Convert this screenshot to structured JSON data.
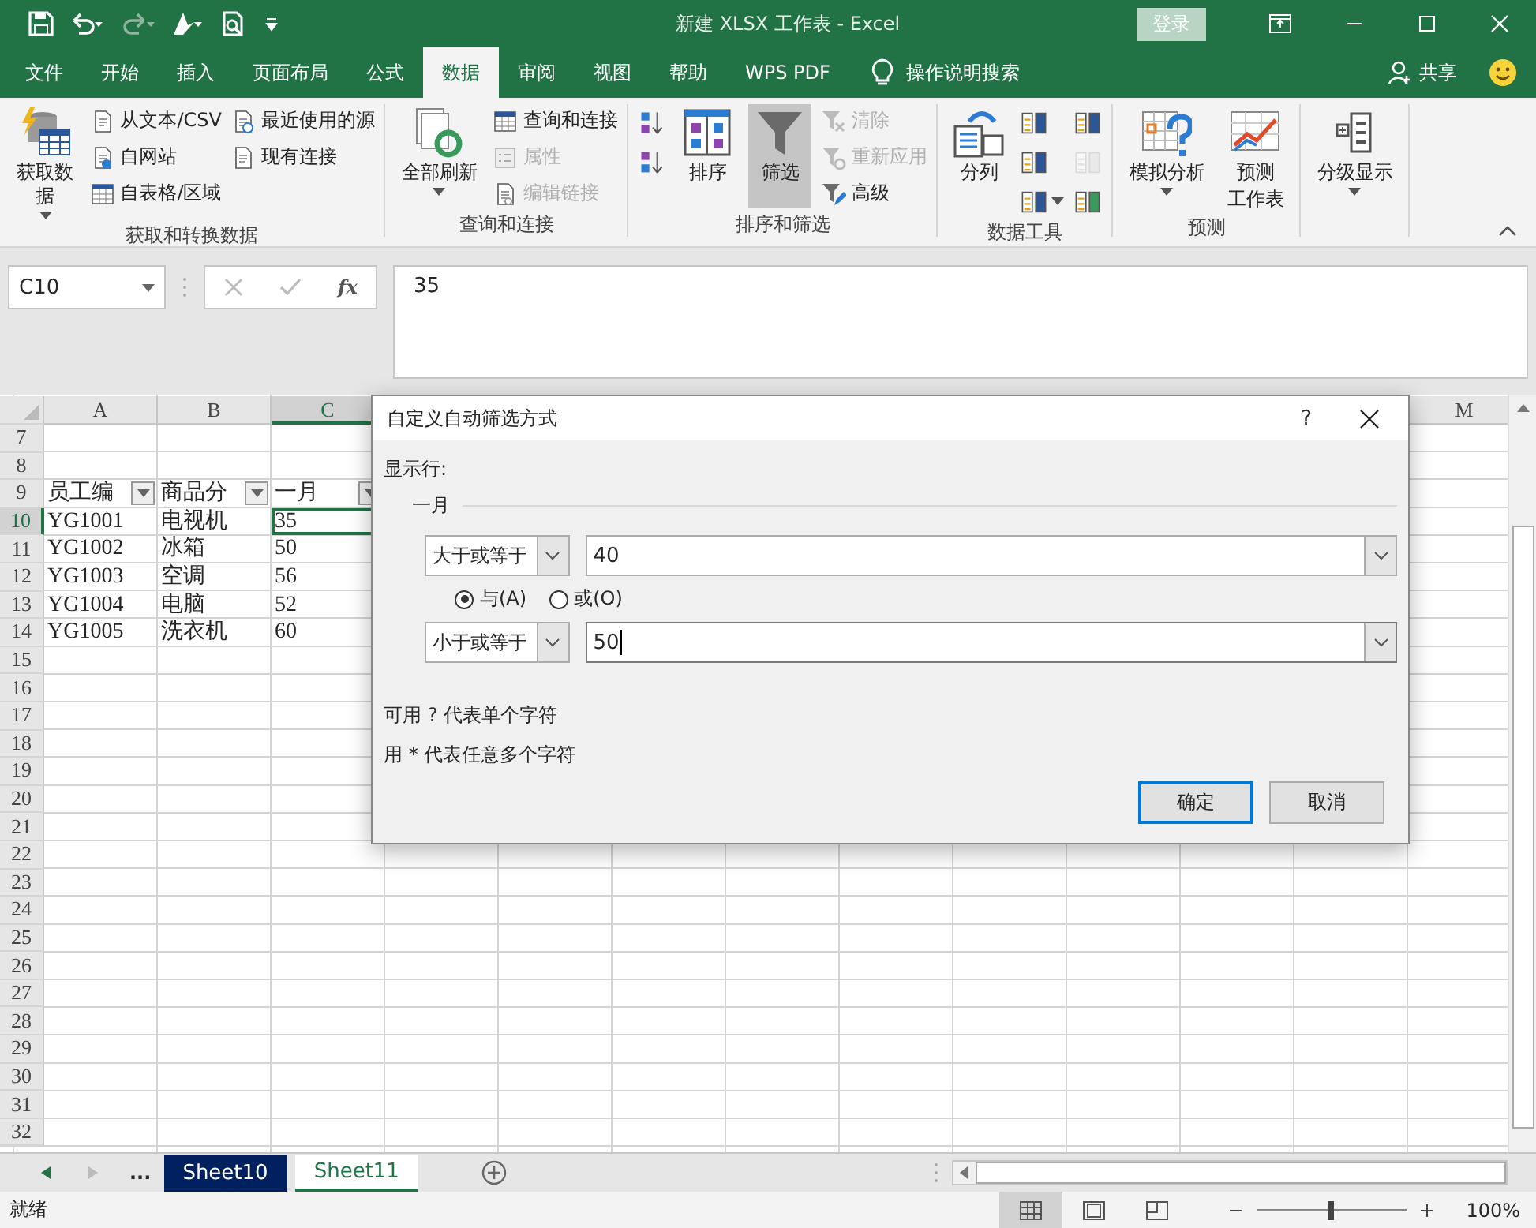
{
  "window": {
    "title": "新建 XLSX 工作表  -  Excel",
    "sign_in": "登录"
  },
  "tabs": [
    {
      "label": "文件",
      "selected": false
    },
    {
      "label": "开始",
      "selected": false
    },
    {
      "label": "插入",
      "selected": false
    },
    {
      "label": "页面布局",
      "selected": false
    },
    {
      "label": "公式",
      "selected": false
    },
    {
      "label": "数据",
      "selected": true
    },
    {
      "label": "审阅",
      "selected": false
    },
    {
      "label": "视图",
      "selected": false
    },
    {
      "label": "帮助",
      "selected": false
    },
    {
      "label": "WPS PDF",
      "selected": false
    }
  ],
  "tell_me": "操作说明搜索",
  "share": "共享",
  "ribbon": [
    {
      "label": "获取和转换数据",
      "columns": [
        {
          "kind": "large",
          "lines": [
            "获取数据"
          ],
          "dropdown": true,
          "pressed": false
        },
        {
          "kind": "stack",
          "items": [
            {
              "label": "从文本/CSV",
              "disabled": false
            },
            {
              "label": "自网站",
              "disabled": false
            },
            {
              "label": "自表格/区域",
              "disabled": false
            }
          ]
        },
        {
          "kind": "stack",
          "items": [
            {
              "label": "最近使用的源",
              "disabled": false
            },
            {
              "label": "现有连接",
              "disabled": false
            }
          ]
        }
      ]
    },
    {
      "label": "查询和连接",
      "columns": [
        {
          "kind": "large",
          "lines": [
            "全部刷新"
          ],
          "dropdown": true,
          "pressed": false
        },
        {
          "kind": "stack",
          "items": [
            {
              "label": "查询和连接",
              "disabled": false
            },
            {
              "label": "属性",
              "disabled": true
            },
            {
              "label": "编辑链接",
              "disabled": true
            }
          ]
        }
      ]
    },
    {
      "label": "排序和筛选",
      "columns": [
        {
          "kind": "icons",
          "items": [
            {
              "disabled": false,
              "dropdown": false
            },
            {
              "disabled": false,
              "dropdown": false
            }
          ]
        },
        {
          "kind": "large",
          "lines": [
            "排序"
          ],
          "dropdown": false,
          "pressed": false
        },
        {
          "kind": "large",
          "lines": [
            "筛选"
          ],
          "dropdown": false,
          "pressed": true
        },
        {
          "kind": "stack",
          "items": [
            {
              "label": "清除",
              "disabled": true
            },
            {
              "label": "重新应用",
              "disabled": true
            },
            {
              "label": "高级",
              "disabled": false
            }
          ]
        }
      ]
    },
    {
      "label": "数据工具",
      "columns": [
        {
          "kind": "large",
          "lines": [
            "分列"
          ],
          "dropdown": false,
          "pressed": false
        },
        {
          "kind": "icons",
          "items": [
            {
              "disabled": false,
              "dropdown": false
            },
            {
              "disabled": false,
              "dropdown": false
            },
            {
              "disabled": false,
              "dropdown": true
            }
          ]
        },
        {
          "kind": "icons",
          "items": [
            {
              "disabled": false,
              "dropdown": false
            },
            {
              "disabled": true,
              "dropdown": false
            },
            {
              "disabled": false,
              "dropdown": false
            }
          ]
        }
      ]
    },
    {
      "label": "预测",
      "columns": [
        {
          "kind": "large",
          "lines": [
            "模拟分析"
          ],
          "dropdown": true,
          "pressed": false
        },
        {
          "kind": "large",
          "lines": [
            "预测",
            "工作表"
          ],
          "dropdown": false,
          "pressed": false
        }
      ]
    },
    {
      "columns": [
        {
          "kind": "large",
          "lines": [
            "分级显示"
          ],
          "dropdown": true,
          "pressed": false
        }
      ]
    }
  ],
  "formula_bar": {
    "name_box": "C10",
    "fx": "fx",
    "formula": "35"
  },
  "grid": {
    "columns": [
      {
        "label": "A",
        "selected": false
      },
      {
        "label": "B",
        "selected": false
      },
      {
        "label": "C",
        "selected": true
      },
      {
        "label": "M",
        "selected": false
      }
    ],
    "rows": [
      {
        "number": "7",
        "selected": false
      },
      {
        "number": "8",
        "selected": false
      },
      {
        "number": "9",
        "selected": false,
        "cells": [
          {
            "text": "员工编",
            "filter": true,
            "selected": false
          },
          {
            "text": "商品分",
            "filter": true,
            "selected": false
          },
          {
            "text": "一月",
            "filter": true,
            "selected": false
          }
        ]
      },
      {
        "number": "10",
        "selected": true,
        "cells": [
          {
            "text": "YG1001",
            "filter": false,
            "selected": false
          },
          {
            "text": "电视机",
            "filter": false,
            "selected": false
          },
          {
            "text": "35",
            "filter": false,
            "selected": true
          }
        ]
      },
      {
        "number": "11",
        "selected": false,
        "cells": [
          {
            "text": "YG1002",
            "filter": false,
            "selected": false
          },
          {
            "text": "冰箱",
            "filter": false,
            "selected": false
          },
          {
            "text": "50",
            "filter": false,
            "selected": false
          }
        ]
      },
      {
        "number": "12",
        "selected": false,
        "cells": [
          {
            "text": "YG1003",
            "filter": false,
            "selected": false
          },
          {
            "text": "空调",
            "filter": false,
            "selected": false
          },
          {
            "text": "56",
            "filter": false,
            "selected": false
          }
        ]
      },
      {
        "number": "13",
        "selected": false,
        "cells": [
          {
            "text": "YG1004",
            "filter": false,
            "selected": false
          },
          {
            "text": "电脑",
            "filter": false,
            "selected": false
          },
          {
            "text": "52",
            "filter": false,
            "selected": false
          }
        ]
      },
      {
        "number": "14",
        "selected": false,
        "cells": [
          {
            "text": "YG1005",
            "filter": false,
            "selected": false
          },
          {
            "text": "洗衣机",
            "filter": false,
            "selected": false
          },
          {
            "text": "60",
            "filter": false,
            "selected": false
          }
        ]
      },
      {
        "number": "15",
        "selected": false
      },
      {
        "number": "16",
        "selected": false
      },
      {
        "number": "17",
        "selected": false
      },
      {
        "number": "18",
        "selected": false
      },
      {
        "number": "19",
        "selected": false
      },
      {
        "number": "20",
        "selected": false
      },
      {
        "number": "21",
        "selected": false
      },
      {
        "number": "22",
        "selected": false
      },
      {
        "number": "23",
        "selected": false
      },
      {
        "number": "24",
        "selected": false
      },
      {
        "number": "25",
        "selected": false
      },
      {
        "number": "26",
        "selected": false
      },
      {
        "number": "27",
        "selected": false
      },
      {
        "number": "28",
        "selected": false
      },
      {
        "number": "29",
        "selected": false
      },
      {
        "number": "30",
        "selected": false
      },
      {
        "number": "31",
        "selected": false
      },
      {
        "number": "32",
        "selected": false
      }
    ]
  },
  "dialog": {
    "title": "自定义自动筛选方式",
    "help": "?",
    "show_rows": "显示行:",
    "field": "一月",
    "conditions": [
      {
        "operator": "大于或等于",
        "value": "40",
        "focused": false
      },
      {
        "operator": "小于或等于",
        "value": "50",
        "focused": true
      }
    ],
    "logic": [
      {
        "label": "与(A)",
        "selected": true
      },
      {
        "label": "或(O)",
        "selected": false
      }
    ],
    "hints": [
      "可用 ? 代表单个字符",
      "用 * 代表任意多个字符"
    ],
    "buttons": [
      {
        "label": "确定",
        "default": true
      },
      {
        "label": "取消",
        "default": false
      }
    ]
  },
  "sheets": {
    "more": "...",
    "tabs": [
      {
        "label": "Sheet10",
        "selected": false,
        "color": "#002060"
      },
      {
        "label": "Sheet11",
        "selected": true,
        "color": "#ffffff"
      }
    ]
  },
  "status_bar": {
    "status": "就绪",
    "views": [
      {
        "selected": true
      },
      {
        "selected": false
      },
      {
        "selected": false
      }
    ],
    "zoom_slider": {
      "level": 0.5
    },
    "zoom": "100%"
  }
}
